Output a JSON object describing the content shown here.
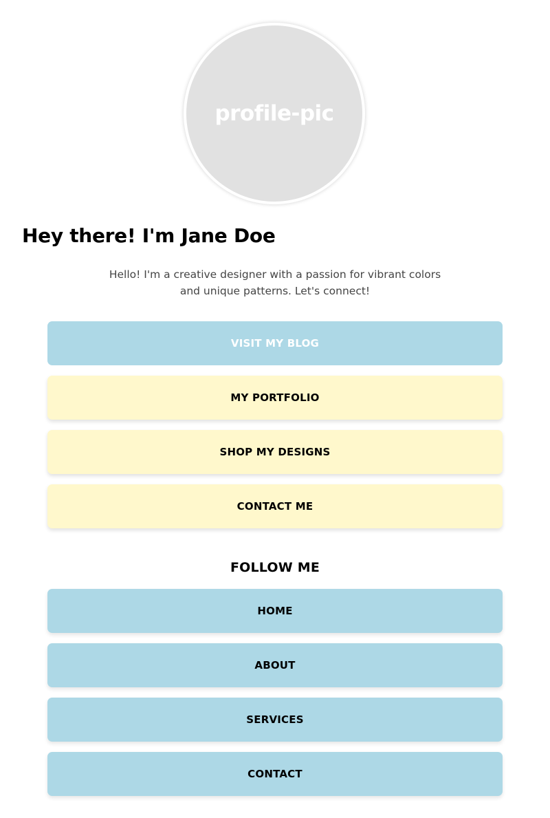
{
  "profile": {
    "avatar_label": "profile-pic",
    "title": "Hey there! I'm Jane Doe",
    "bio": "Hello! I'm a creative designer with a passion for vibrant colors and unique patterns. Let's connect!"
  },
  "links": [
    {
      "label": "VISIT MY BLOG",
      "color": "#add8e6",
      "text_color": "#ffffff"
    },
    {
      "label": "MY PORTFOLIO",
      "color": "#fff8cc",
      "text_color": "#000000"
    },
    {
      "label": "SHOP MY DESIGNS",
      "color": "#fff8cc",
      "text_color": "#000000"
    },
    {
      "label": "CONTACT ME",
      "color": "#fff8cc",
      "text_color": "#000000"
    }
  ],
  "follow": {
    "heading": "FOLLOW ME",
    "items": [
      {
        "label": "HOME",
        "color": "#add8e6"
      },
      {
        "label": "ABOUT",
        "color": "#add8e6"
      },
      {
        "label": "SERVICES",
        "color": "#add8e6"
      },
      {
        "label": "CONTACT",
        "color": "#add8e6"
      }
    ]
  },
  "colors": {
    "avatar_bg": "#e1e1e1",
    "blue": "#add8e6",
    "yellow": "#fff8cc",
    "bio_text": "#444444"
  }
}
